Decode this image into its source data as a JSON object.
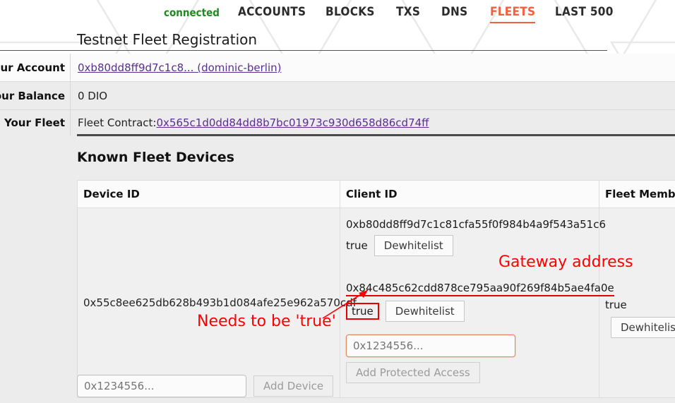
{
  "nav": {
    "status": "connected",
    "items": [
      {
        "label": "ACCOUNTS",
        "active": false
      },
      {
        "label": "BLOCKS",
        "active": false
      },
      {
        "label": "TXS",
        "active": false
      },
      {
        "label": "DNS",
        "active": false
      },
      {
        "label": "FLEETS",
        "active": true
      },
      {
        "label": "LAST 500",
        "active": false
      }
    ],
    "accent_color": "#f4603e",
    "status_color": "#1f8a1f"
  },
  "page": {
    "title": "Testnet Fleet Registration"
  },
  "info": {
    "account_label": "Your Account",
    "account_value": "0xb80dd8ff9d7c1c8... (dominic-berlin)",
    "balance_label": "Your Balance",
    "balance_value": "0 DIO",
    "fleet_label": "Your Fleet",
    "fleet_prefix": "Fleet Contract: ",
    "fleet_contract": "0x565c1d0dd84dd8b7bc01973c930d658d86cd74ff"
  },
  "devices": {
    "heading": "Known Fleet Devices",
    "columns": [
      "Device ID",
      "Client ID",
      "Fleet Member"
    ],
    "rows": [
      {
        "device_id": "0x55c8ee625db628b493b1d084afe25e962a570cdf",
        "clients": [
          {
            "hash": "0xb80dd8ff9d7c1c81cfa55f0f984b4a9f543a51c6",
            "flag": "true",
            "button": "Dewhitelist",
            "highlighted": false
          },
          {
            "hash": "0x84c485c62cdd878ce795aa90f269f84b5ae4fa0e",
            "flag": "true",
            "button": "Dewhitelist",
            "highlighted": true
          }
        ],
        "protected_access": {
          "placeholder": "0x1234556...",
          "value": "",
          "button": "Add Protected Access"
        },
        "member": {
          "flag": "true",
          "button": "Dewhitelist"
        }
      }
    ],
    "add_device": {
      "placeholder": "0x1234556...",
      "value": "",
      "button": "Add Device"
    }
  },
  "annotations": {
    "gateway": "Gateway address",
    "needs_true": "Needs to be 'true'",
    "color": "#ff0000"
  }
}
